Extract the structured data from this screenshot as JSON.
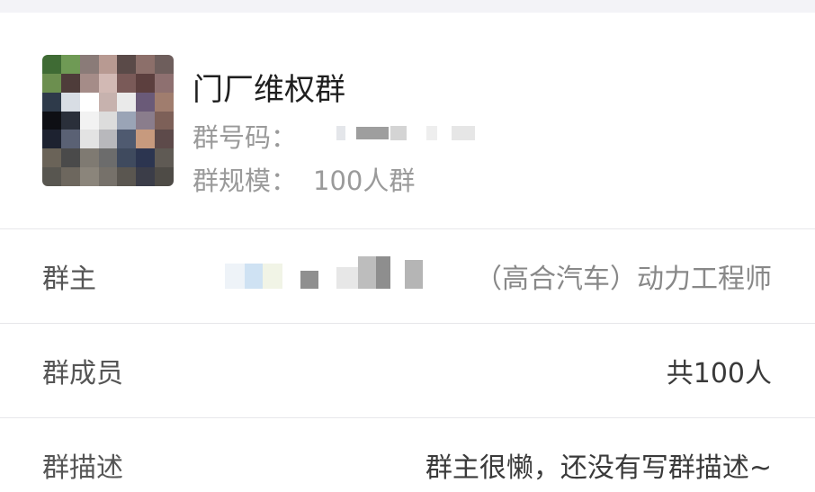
{
  "group": {
    "name": "门厂维权群",
    "id_label": "群号码：",
    "size_label": "群规模：",
    "size_value": "100人群"
  },
  "rows": {
    "owner_label": "群主",
    "owner_title": "（高合汽车）动力工程师",
    "members_label": "群成员",
    "members_value": "共100人",
    "desc_label": "群描述",
    "desc_value": "群主很懒，还没有写群描述~"
  },
  "colors": {
    "background": "#ffffff",
    "top_strip": "#f3f3f7",
    "divider": "#e7e7ea",
    "text_primary": "#1f1f1f",
    "text_secondary": "#9a9a9a",
    "label": "#555555"
  }
}
